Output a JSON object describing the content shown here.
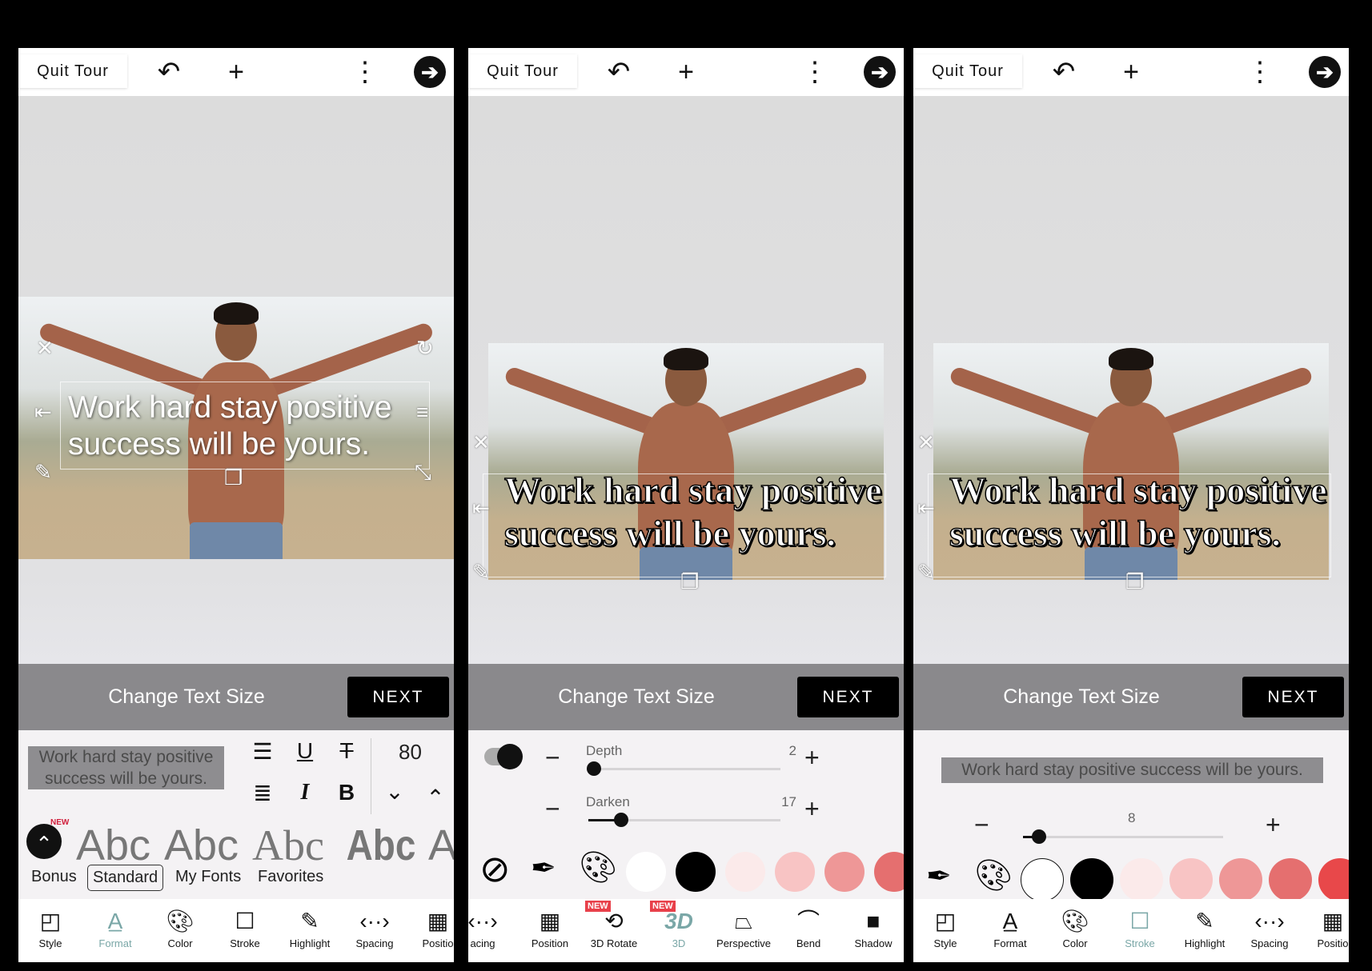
{
  "panels": [
    {
      "topbar": {
        "quit_label": "Quit Tour"
      },
      "canvas_text": [
        "Work hard stay positive",
        "success will be yours."
      ],
      "hint": {
        "text": "Change Text Size",
        "next_label": "NEXT"
      },
      "format": {
        "preview": [
          "Work hard stay positive",
          "success will be yours."
        ],
        "size_value": "80",
        "new_badge": "NEW",
        "font_samples": [
          "Abc",
          "Abc",
          "Abc",
          "Abc",
          "A"
        ],
        "font_tabs": [
          {
            "label": "Bonus"
          },
          {
            "label": "Standard",
            "selected": true
          },
          {
            "label": "My Fonts"
          },
          {
            "label": "Favorites"
          }
        ]
      },
      "nav": [
        {
          "label": "Style",
          "icon": "style-icon"
        },
        {
          "label": "Format",
          "icon": "format-icon",
          "active": true
        },
        {
          "label": "Color",
          "icon": "palette-icon"
        },
        {
          "label": "Stroke",
          "icon": "stroke-icon"
        },
        {
          "label": "Highlight",
          "icon": "highlight-icon"
        },
        {
          "label": "Spacing",
          "icon": "spacing-icon"
        },
        {
          "label": "Positio",
          "icon": "position-icon"
        }
      ]
    },
    {
      "topbar": {
        "quit_label": "Quit Tour"
      },
      "canvas_text": [
        "Work hard stay positive",
        "success will be yours."
      ],
      "hint": {
        "text": "Change Text Size",
        "next_label": "NEXT"
      },
      "three_d": {
        "toggle_on": true,
        "depth": {
          "label": "Depth",
          "value": "2",
          "fraction": 0.03
        },
        "darken": {
          "label": "Darken",
          "value": "17",
          "fraction": 0.17
        }
      },
      "colors": [
        "#ffffff",
        "#000000",
        "#fbeaea",
        "#f8c4c4",
        "#ee9797",
        "#e56f6f"
      ],
      "nav": [
        {
          "label": "acing",
          "icon": "spacing-icon"
        },
        {
          "label": "Position",
          "icon": "position-icon"
        },
        {
          "label": "3D Rotate",
          "icon": "3d-rotate-icon",
          "badge": "NEW"
        },
        {
          "label": "3D",
          "icon": "3d-icon",
          "badge": "NEW",
          "active": true
        },
        {
          "label": "Perspective",
          "icon": "perspective-icon"
        },
        {
          "label": "Bend",
          "icon": "bend-icon"
        },
        {
          "label": "Shadow",
          "icon": "shadow-icon"
        }
      ]
    },
    {
      "topbar": {
        "quit_label": "Quit Tour"
      },
      "canvas_text": [
        "Work hard stay positive",
        "success will be yours."
      ],
      "hint": {
        "text": "Change Text Size",
        "next_label": "NEXT"
      },
      "stroke": {
        "preview": "Work hard stay positive success will be yours.",
        "width": {
          "value": "8",
          "fraction": 0.08
        }
      },
      "colors": [
        "#ffffff",
        "#000000",
        "#fbeaea",
        "#f8c4c4",
        "#ee9797",
        "#e56f6f",
        "#e8484a"
      ],
      "nav": [
        {
          "label": "Style",
          "icon": "style-icon"
        },
        {
          "label": "Format",
          "icon": "format-icon"
        },
        {
          "label": "Color",
          "icon": "palette-icon"
        },
        {
          "label": "Stroke",
          "icon": "stroke-icon",
          "active": true
        },
        {
          "label": "Highlight",
          "icon": "highlight-icon"
        },
        {
          "label": "Spacing",
          "icon": "spacing-icon"
        },
        {
          "label": "Positio",
          "icon": "position-icon"
        }
      ]
    }
  ]
}
